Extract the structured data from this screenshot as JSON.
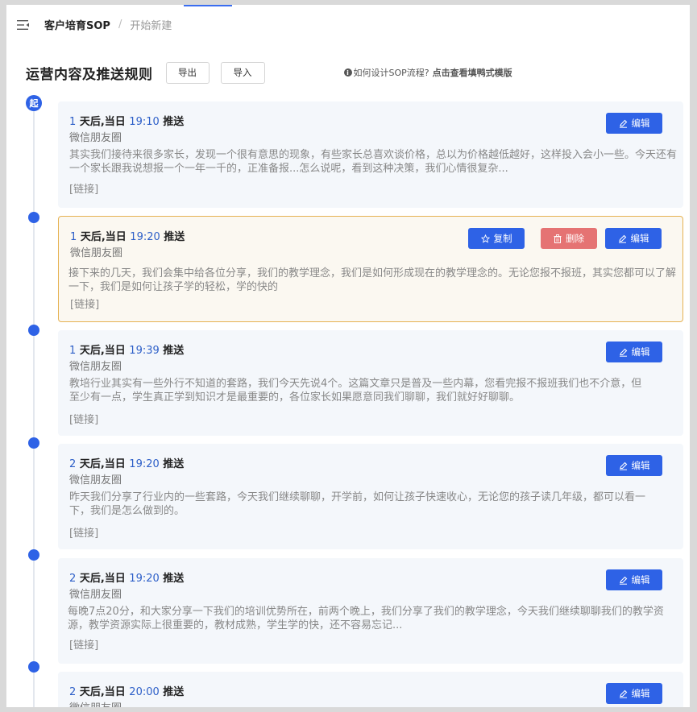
{
  "header": {
    "breadcrumb": [
      "客户培育SOP",
      "开始新建"
    ],
    "separator": "/"
  },
  "toolbar": {
    "title": "运营内容及推送规则",
    "export_label": "导出",
    "import_label": "导入",
    "help_prefix": "如何设计SOP流程?",
    "help_link": "点击查看填鸭式模版"
  },
  "timeline": {
    "start_label": "起"
  },
  "actions": {
    "copy": "复制",
    "delete": "删除",
    "edit": "编辑"
  },
  "colors": {
    "accent": "#2e62e6",
    "danger": "#e57373",
    "selected_border": "#e6b252"
  },
  "items": [
    {
      "day": "1",
      "day_suffix": "天后,当日",
      "time": "19:10",
      "action": "推送",
      "channel": "微信朋友圈",
      "content": "其实我们接待来很多家长，发现一个很有意思的现象，有些家长总喜欢谈价格，总以为价格越低越好，这样投入会小一些。今天还有一个家长跟我说想报一个一年一千的，正准备报...怎么说呢，看到这种决策，我们心情很复杂...",
      "link": "[链接]"
    },
    {
      "day": "1",
      "day_suffix": "天后,当日",
      "time": "19:20",
      "action": "推送",
      "channel": "微信朋友圈",
      "content": "接下来的几天，我们会集中给各位分享，我们的教学理念，我们是如何形成现在的教学理念的。无论您报不报班，其实您都可以了解一下，我们是如何让孩子学的轻松，学的快的",
      "link": "[链接]"
    },
    {
      "day": "1",
      "day_suffix": "天后,当日",
      "time": "19:39",
      "action": "推送",
      "channel": "微信朋友圈",
      "content": "教培行业其实有一些外行不知道的套路，我们今天先说4个。这篇文章只是普及一些内幕，您看完报不报班我们也不介意，但至少有一点，学生真正学到知识才是最重要的，各位家长如果愿意同我们聊聊，我们就好好聊聊。",
      "link": "[链接]"
    },
    {
      "day": "2",
      "day_suffix": "天后,当日",
      "time": "19:20",
      "action": "推送",
      "channel": "微信朋友圈",
      "content": "昨天我们分享了行业内的一些套路，今天我们继续聊聊，开学前，如何让孩子快速收心，无论您的孩子读几年级，都可以看一下，我们是怎么做到的。",
      "link": "[链接]"
    },
    {
      "day": "2",
      "day_suffix": "天后,当日",
      "time": "19:20",
      "action": "推送",
      "channel": "微信朋友圈",
      "content": "每晚7点20分，和大家分享一下我们的培训优势所在，前两个晚上，我们分享了我们的教学理念，今天我们继续聊聊我们的教学资源，教学资源实际上很重要的，教材成熟，学生学的快，还不容易忘记...",
      "link": "[链接]"
    },
    {
      "day": "2",
      "day_suffix": "天后,当日",
      "time": "20:00",
      "action": "推送",
      "channel": "微信朋友圈",
      "content": "",
      "link": ""
    }
  ]
}
